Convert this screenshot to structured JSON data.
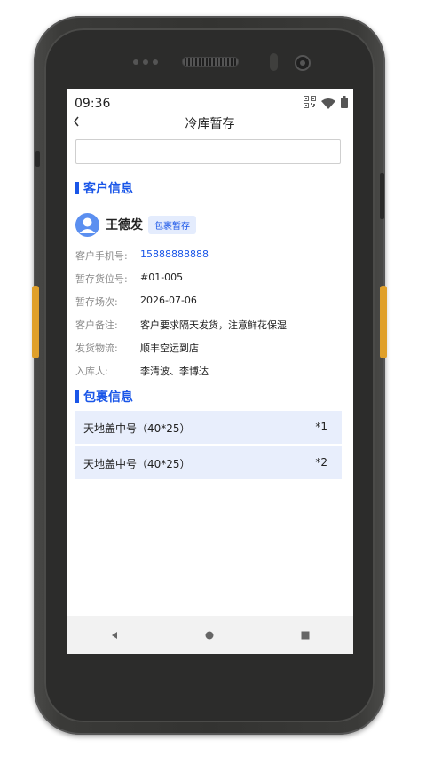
{
  "status_bar": {
    "time": "09:36"
  },
  "nav": {
    "back_glyph": "<",
    "title": "冷库暂存"
  },
  "search": {
    "value": "",
    "placeholder": ""
  },
  "customer_section": {
    "title": "客户信息"
  },
  "customer": {
    "name": "王德发",
    "tag": "包裹暂存"
  },
  "info_rows": [
    {
      "label": "客户手机号:",
      "value": "15888888888"
    },
    {
      "label": "暂存货位号:",
      "value": "#01-005"
    },
    {
      "label": "暂存场次:",
      "value": "2026-07-06"
    },
    {
      "label": "客户备注:",
      "value": "客户要求隔天发货，注意鲜花保湿"
    },
    {
      "label": "发货物流:",
      "value": "顺丰空运到店"
    },
    {
      "label": "入库人:",
      "value": "李清波、李博达"
    }
  ],
  "package_section": {
    "title": "包裹信息"
  },
  "packages": [
    {
      "name": "天地盖中号（40*25）",
      "qty": "*1"
    },
    {
      "name": "天地盖中号（40*25）",
      "qty": "*2"
    }
  ],
  "icons": {
    "back": "chevron-left-icon",
    "qr": "qr-code-icon",
    "wifi": "wifi-icon",
    "battery": "battery-icon",
    "avatar": "user-icon"
  },
  "colors": {
    "accent": "#1a56e8",
    "tag_bg": "#e4ecfd",
    "package_bg": "#e8eefc",
    "avatar": "#5b8ff0"
  }
}
